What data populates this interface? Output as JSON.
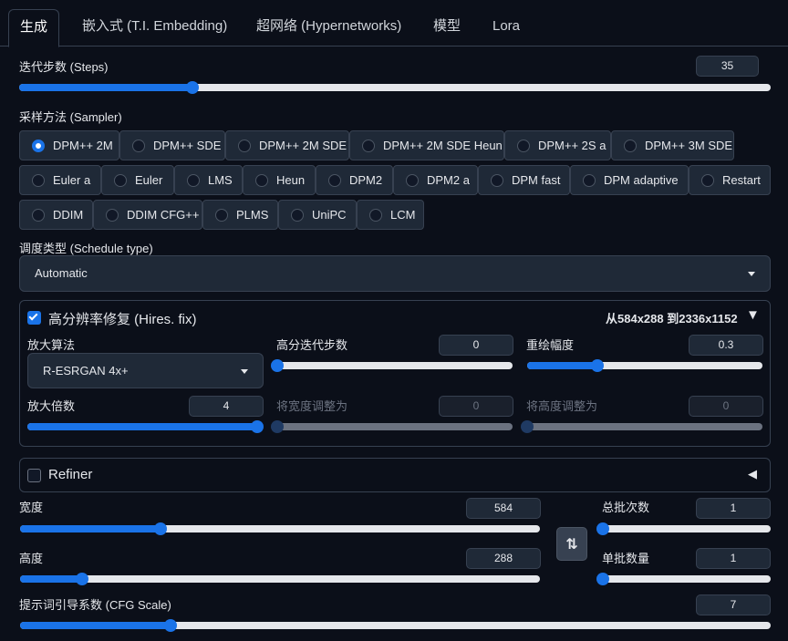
{
  "tabs": [
    "生成",
    "嵌入式 (T.I. Embedding)",
    "超网络 (Hypernetworks)",
    "模型",
    "Lora"
  ],
  "steps": {
    "label": "迭代步数 (Steps)",
    "value": "35",
    "fraction": 0.23
  },
  "sampler": {
    "label": "采样方法 (Sampler)",
    "row1": [
      "DPM++ 2M",
      "DPM++ SDE",
      "DPM++ 2M SDE",
      "DPM++ 2M SDE Heun",
      "DPM++ 2S a",
      "DPM++ 3M SDE"
    ],
    "row2": [
      "Euler a",
      "Euler",
      "LMS",
      "Heun",
      "DPM2",
      "DPM2 a",
      "DPM fast",
      "DPM adaptive",
      "Restart"
    ],
    "row3": [
      "DDIM",
      "DDIM CFG++",
      "PLMS",
      "UniPC",
      "LCM"
    ],
    "selected": "DPM++ 2M"
  },
  "schedule": {
    "label": "调度类型 (Schedule type)",
    "value": "Automatic"
  },
  "hires": {
    "title": "高分辨率修复 (Hires. fix)",
    "summary": "从584x288 到2336x1152",
    "arrow": "▼",
    "upscaler_label": "放大算法",
    "upscaler_value": "R-ESRGAN 4x+",
    "hires_steps_label": "高分迭代步数",
    "hires_steps_value": "0",
    "denoise_label": "重绘幅度",
    "denoise_value": "0.3",
    "upscale_label": "放大倍数",
    "upscale_value": "4",
    "resize_w_label": "将宽度调整为",
    "resize_w_value": "0",
    "resize_h_label": "将高度调整为",
    "resize_h_value": "0"
  },
  "refiner": {
    "title": "Refiner",
    "arrow": "◀"
  },
  "width": {
    "label": "宽度",
    "value": "584",
    "fraction": 0.27
  },
  "height": {
    "label": "高度",
    "value": "288",
    "fraction": 0.12
  },
  "batch_count": {
    "label": "总批次数",
    "value": "1",
    "fraction": 0.0
  },
  "batch_size": {
    "label": "单批数量",
    "value": "1",
    "fraction": 0.0
  },
  "cfg": {
    "label": "提示词引导系数 (CFG Scale)",
    "value": "7",
    "fraction": 0.2
  },
  "swap_icon": "⇅"
}
